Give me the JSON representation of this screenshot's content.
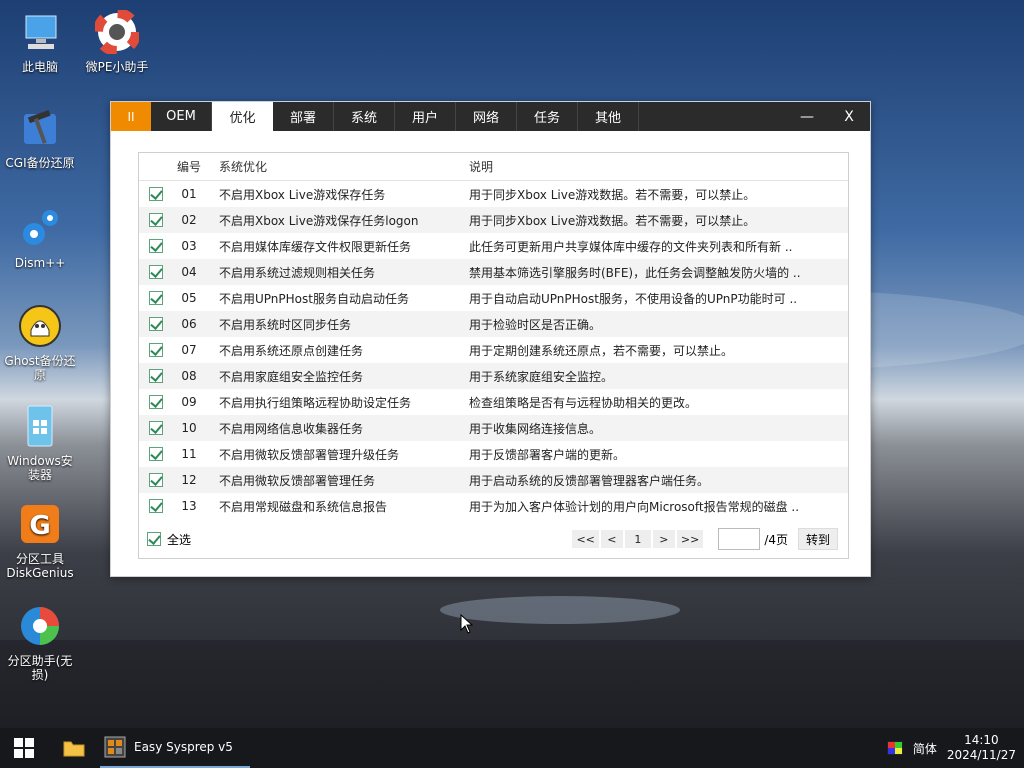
{
  "desktop": {
    "icons": [
      {
        "label": "此电脑",
        "icon": "computer-icon"
      },
      {
        "label": "微PE小助手",
        "icon": "lifebuoy-icon"
      },
      {
        "label": "CGI备份还原",
        "icon": "hammer-icon"
      },
      {
        "label": "Dism++",
        "icon": "gears-icon"
      },
      {
        "label": "Ghost备份还原",
        "icon": "ghost-icon"
      },
      {
        "label": "Windows安装器",
        "icon": "windows-installer-icon"
      },
      {
        "label": "分区工具DiskGenius",
        "icon": "diskgenius-icon"
      },
      {
        "label": "分区助手(无损)",
        "icon": "partition-assistant-icon"
      }
    ]
  },
  "window": {
    "tabs": [
      "OEM",
      "优化",
      "部署",
      "系统",
      "用户",
      "网络",
      "任务",
      "其他"
    ],
    "logo_label": "II",
    "active_tab": "优化",
    "minimize_label": "—",
    "close_label": "X",
    "table": {
      "headers": {
        "num": "编号",
        "name": "系统优化",
        "desc": "说明"
      },
      "rows": [
        {
          "num": "01",
          "name": "不启用Xbox Live游戏保存任务",
          "desc": "用于同步Xbox Live游戏数据。若不需要，可以禁止。"
        },
        {
          "num": "02",
          "name": "不启用Xbox Live游戏保存任务logon",
          "desc": "用于同步Xbox Live游戏数据。若不需要，可以禁止。"
        },
        {
          "num": "03",
          "name": "不启用媒体库缓存文件权限更新任务",
          "desc": "此任务可更新用户共享媒体库中缓存的文件夹列表和所有新 .."
        },
        {
          "num": "04",
          "name": "不启用系统过滤规则相关任务",
          "desc": "禁用基本筛选引擎服务时(BFE)，此任务会调整触发防火墙的 .."
        },
        {
          "num": "05",
          "name": "不启用UPnPHost服务自动启动任务",
          "desc": "用于自动启动UPnPHost服务，不使用设备的UPnP功能时可 .."
        },
        {
          "num": "06",
          "name": "不启用系统时区同步任务",
          "desc": "用于检验时区是否正确。"
        },
        {
          "num": "07",
          "name": "不启用系统还原点创建任务",
          "desc": "用于定期创建系统还原点，若不需要，可以禁止。"
        },
        {
          "num": "08",
          "name": "不启用家庭组安全监控任务",
          "desc": "用于系统家庭组安全监控。"
        },
        {
          "num": "09",
          "name": "不启用执行组策略远程协助设定任务",
          "desc": "检查组策略是否有与远程协助相关的更改。"
        },
        {
          "num": "10",
          "name": "不启用网络信息收集器任务",
          "desc": "用于收集网络连接信息。"
        },
        {
          "num": "11",
          "name": "不启用微软反馈部署管理升级任务",
          "desc": "用于反馈部署客户端的更新。"
        },
        {
          "num": "12",
          "name": "不启用微软反馈部署管理任务",
          "desc": "用于启动系统的反馈部署管理器客户端任务。"
        },
        {
          "num": "13",
          "name": "不启用常规磁盘和系统信息报告",
          "desc": "用于为加入客户体验计划的用户向Microsoft报告常规的磁盘 .."
        }
      ]
    },
    "footer": {
      "select_all": "全选",
      "first": "<<",
      "prev": "<",
      "page": "1",
      "next": ">",
      "last": ">>",
      "page_input": "",
      "total": "/4页",
      "go": "转到"
    }
  },
  "taskbar": {
    "app_label": "Easy Sysprep v5",
    "ime": "简体",
    "time": "14:10",
    "date": "2024/11/27"
  }
}
